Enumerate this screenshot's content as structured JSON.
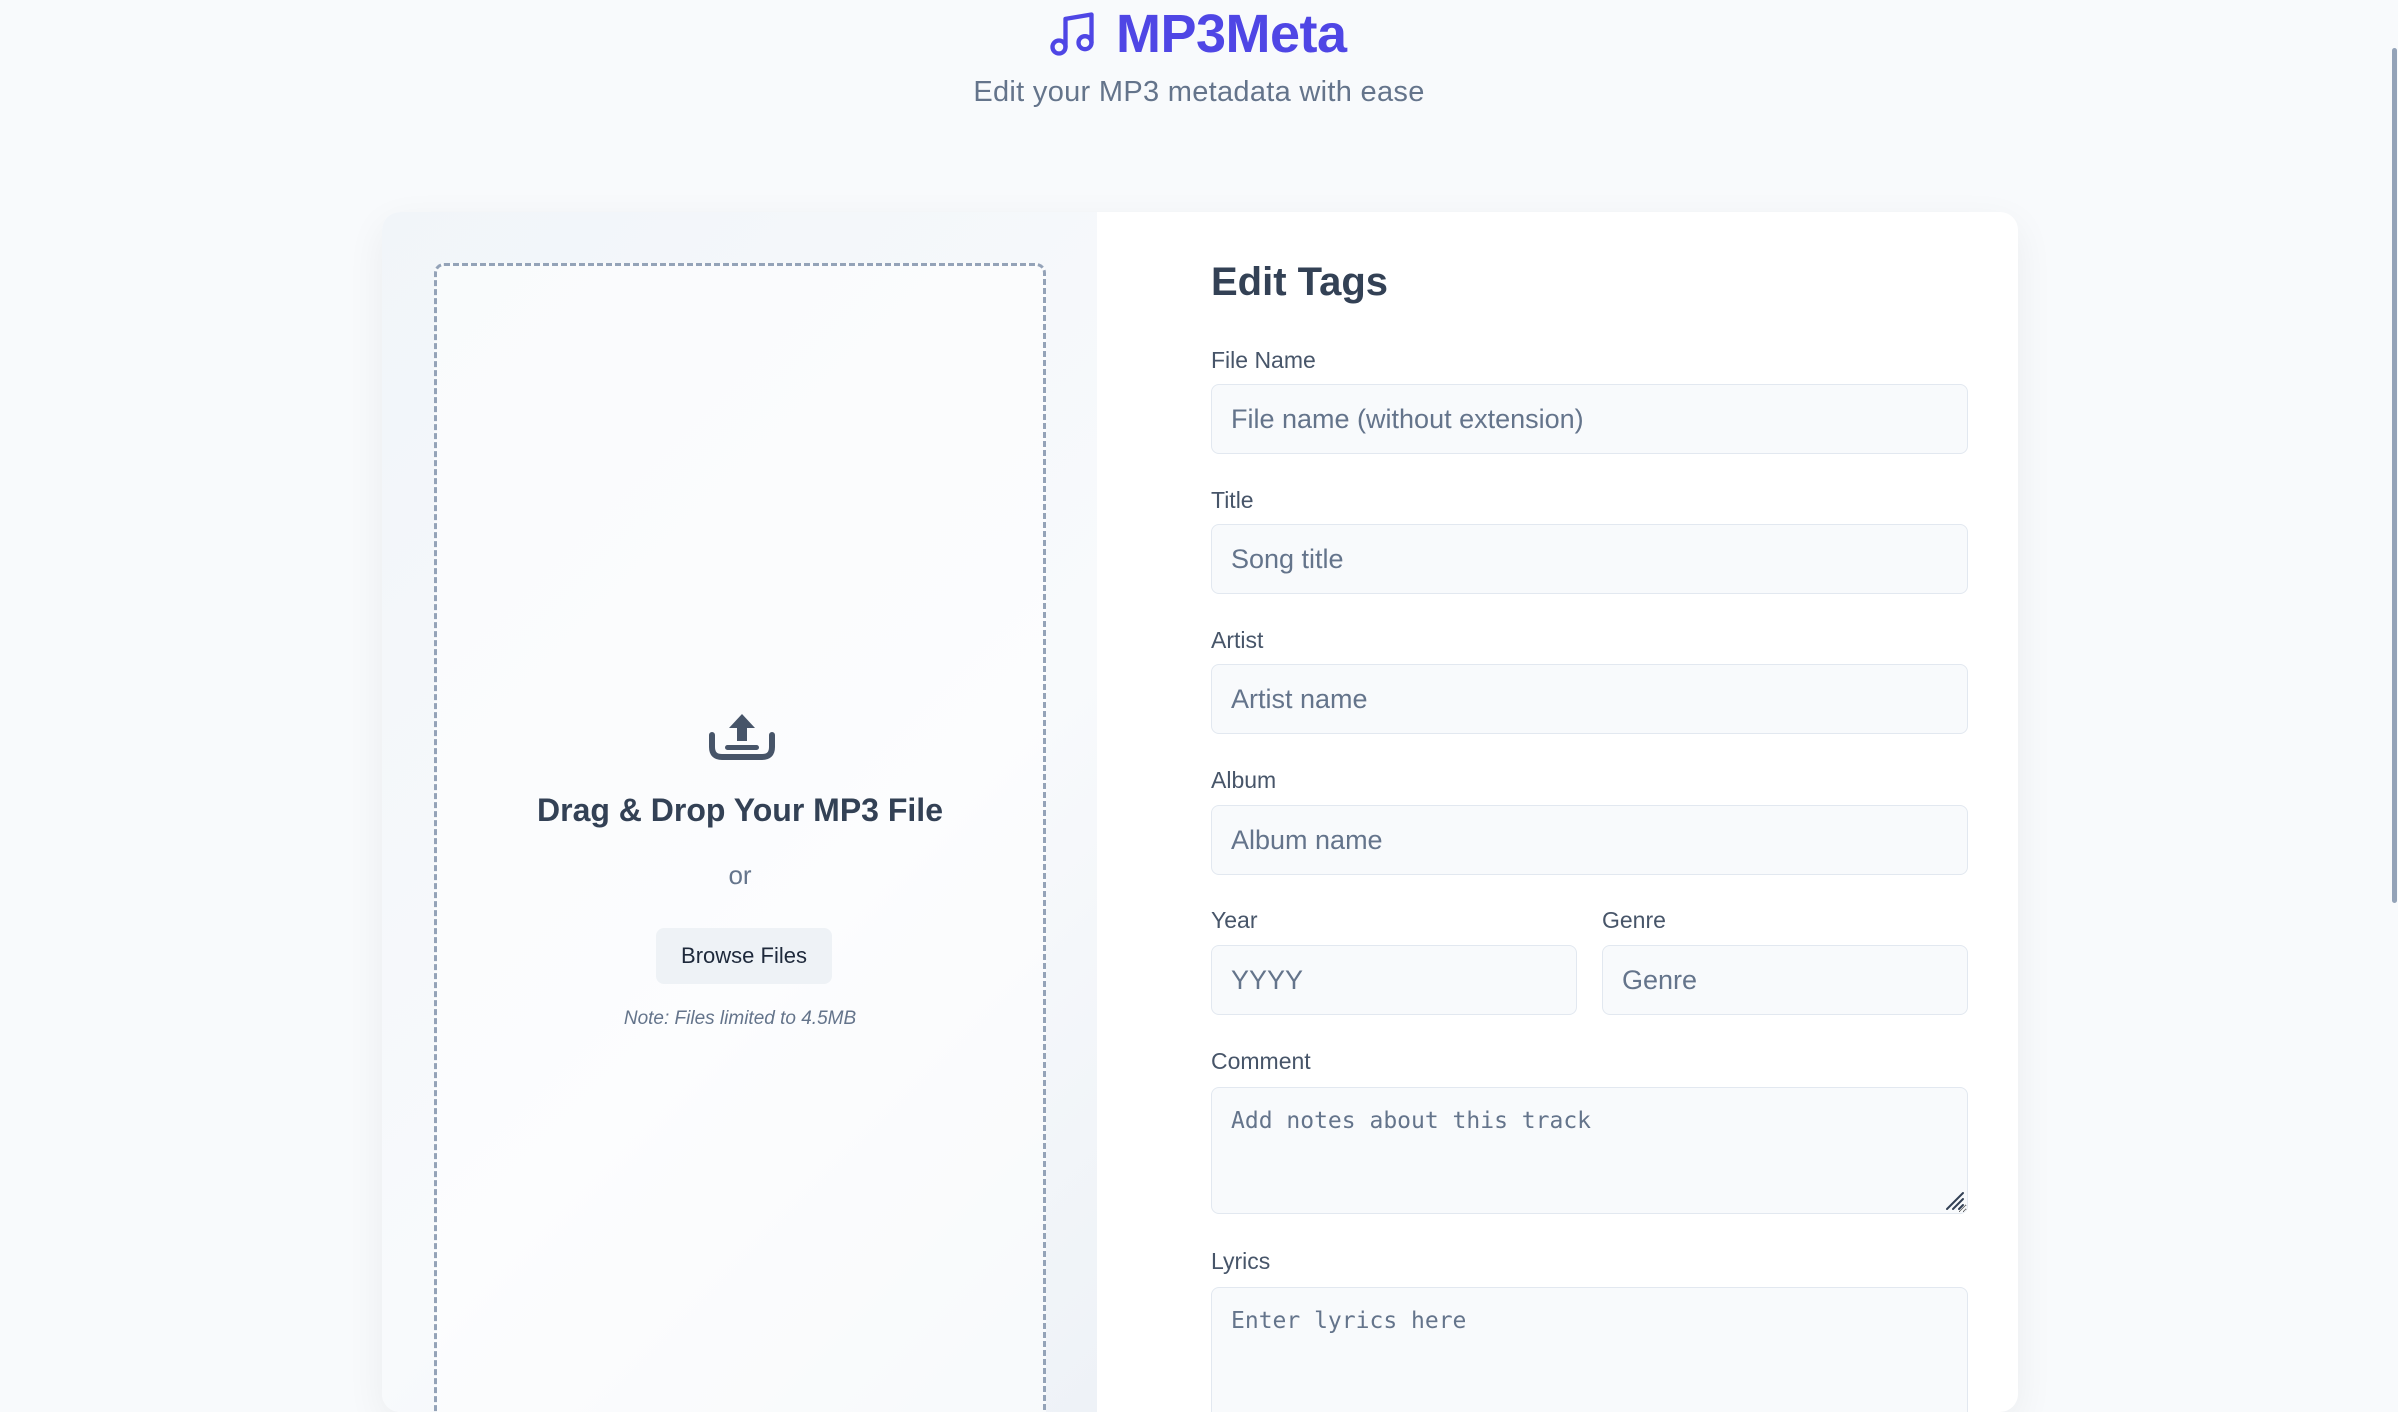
{
  "header": {
    "brand_icon": "music-note-icon",
    "title": "MP3Meta",
    "tagline": "Edit your MP3 metadata with ease",
    "accent_color": "#4f46e5"
  },
  "dropzone": {
    "icon": "upload-icon",
    "title": "Drag & Drop Your MP3 File",
    "or_text": "or",
    "browse_label": "Browse Files",
    "note": "Note: Files limited to 4.5MB"
  },
  "form": {
    "title": "Edit Tags",
    "file_name": {
      "label": "File Name",
      "value": "",
      "placeholder": "File name (without extension)"
    },
    "title_field": {
      "label": "Title",
      "value": "",
      "placeholder": "Song title"
    },
    "artist": {
      "label": "Artist",
      "value": "",
      "placeholder": "Artist name"
    },
    "album": {
      "label": "Album",
      "value": "",
      "placeholder": "Album name"
    },
    "year": {
      "label": "Year",
      "value": "",
      "placeholder": "YYYY"
    },
    "genre": {
      "label": "Genre",
      "value": "",
      "placeholder": "Genre"
    },
    "comment": {
      "label": "Comment",
      "value": "",
      "placeholder": "Add notes about this track"
    },
    "lyrics": {
      "label": "Lyrics",
      "value": "",
      "placeholder": "Enter lyrics here"
    }
  }
}
